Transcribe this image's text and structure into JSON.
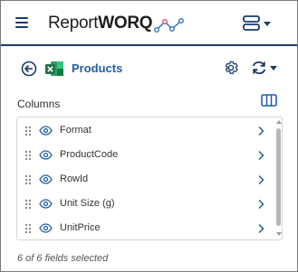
{
  "header": {
    "logo_text_prefix": "Report",
    "logo_text_bold": "WORQ",
    "menu_icon": "hamburger-icon",
    "right_icon": "server-stack-icon"
  },
  "toolbar": {
    "title": "Products",
    "back_icon": "back-arrow-circle-icon",
    "file_icon": "excel-icon",
    "settings_icon": "gear-icon",
    "refresh_icon": "refresh-icon"
  },
  "columns": {
    "heading": "Columns",
    "items": [
      {
        "label": "Format"
      },
      {
        "label": "ProductCode"
      },
      {
        "label": "RowId"
      },
      {
        "label": "Unit Size (g)"
      },
      {
        "label": "UnitPrice"
      }
    ],
    "footer": "6 of 6 fields selected"
  },
  "colors": {
    "accent": "#1f5fa8",
    "header_rule": "#1f3a66",
    "excel_green": "#1e7145"
  }
}
